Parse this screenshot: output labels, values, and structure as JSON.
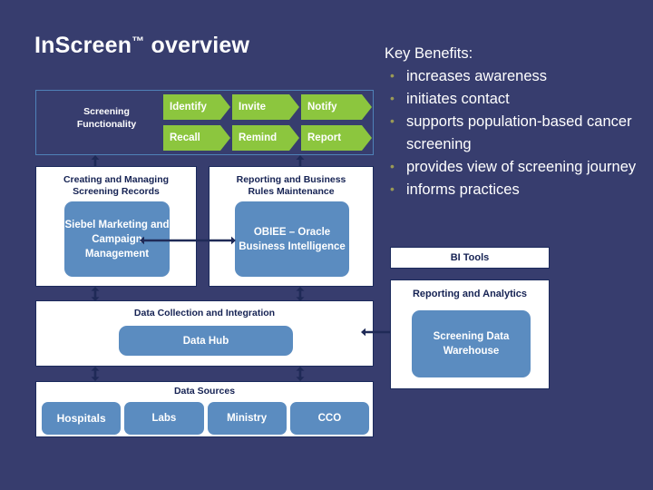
{
  "slide": {
    "title_main": "InScreen",
    "title_tm": "™",
    "title_suffix": " overview",
    "background_color": "#373D6E"
  },
  "colors": {
    "background_navy": "#373D6E",
    "chevron_green": "#8CC63E",
    "box_blue": "#5B8CC0",
    "panel_border": "#1B2A5C",
    "panel_border_light": "#4F82B8",
    "heading_text": "#152253",
    "bullet": "#9A9A55",
    "arrow": "#1F2A57"
  },
  "screening": {
    "label": "Screening\nFunctionality",
    "label_line1": "Screening",
    "label_line2": "Functionality",
    "row1": [
      {
        "label": "Identify"
      },
      {
        "label": "Invite"
      },
      {
        "label": "Notify"
      }
    ],
    "row2": [
      {
        "label": "Recall"
      },
      {
        "label": "Remind"
      },
      {
        "label": "Report"
      }
    ]
  },
  "panels": {
    "records": {
      "heading_line1": "Creating and Managing",
      "heading_line2": "Screening Records",
      "box_label": "Siebel Marketing and Campaign Management"
    },
    "reporting": {
      "heading_line1": "Reporting and Business",
      "heading_line2": "Rules Maintenance",
      "box_label": "OBIEE – Oracle Business Intelligence"
    },
    "collection": {
      "heading": "Data Collection and Integration",
      "box_label": "Data Hub"
    },
    "sources": {
      "heading": "Data Sources",
      "items": [
        {
          "label": "Hospitals"
        },
        {
          "label": "Labs"
        },
        {
          "label": "Ministry"
        },
        {
          "label": "CCO"
        }
      ]
    },
    "bi_tools": {
      "heading": "BI Tools"
    },
    "analytics": {
      "heading": "Reporting and Analytics",
      "box_label": "Screening Data Warehouse"
    }
  },
  "benefits": {
    "title": "Key Benefits:",
    "items": [
      {
        "label": "increases awareness"
      },
      {
        "label": "initiates contact"
      },
      {
        "label": "supports population-based cancer screening"
      },
      {
        "label": "provides view of screening journey"
      },
      {
        "label": "informs practices"
      }
    ]
  }
}
